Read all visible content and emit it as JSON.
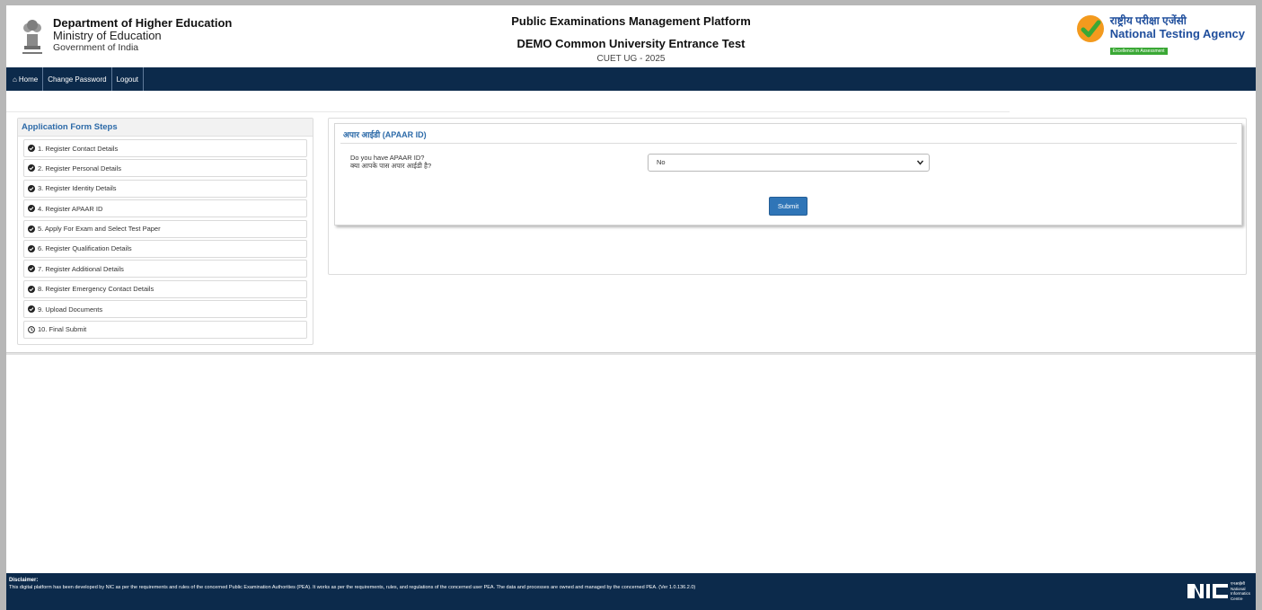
{
  "header": {
    "dept_title": "Department of Higher Education",
    "ministry": "Ministry of Education",
    "government": "Government of India",
    "platform_title": "Public Examinations Management Platform",
    "exam_title": "DEMO Common University Entrance Test",
    "exam_code": "CUET UG - 2025",
    "agency_hindi": "राष्ट्रीय परीक्षा एजेंसी",
    "agency_name": "National Testing Agency",
    "agency_tagline": "Excellence in Assessment"
  },
  "nav": {
    "home": "Home",
    "change_password": "Change Password",
    "logout": "Logout"
  },
  "sidebar": {
    "title": "Application Form Steps",
    "steps": [
      {
        "label": "1. Register Contact Details",
        "status": "done"
      },
      {
        "label": "2. Register Personal Details",
        "status": "done"
      },
      {
        "label": "3. Register Identity Details",
        "status": "done"
      },
      {
        "label": "4. Register APAAR ID",
        "status": "done"
      },
      {
        "label": "5. Apply For Exam and Select Test Paper",
        "status": "done"
      },
      {
        "label": "6. Register Qualification Details",
        "status": "done"
      },
      {
        "label": "7. Register Additional Details",
        "status": "done"
      },
      {
        "label": "8. Register Emergency Contact Details",
        "status": "done"
      },
      {
        "label": "9. Upload Documents",
        "status": "done"
      },
      {
        "label": "10. Final Submit",
        "status": "pending"
      }
    ]
  },
  "form": {
    "title": "अपार आईडी (APAAR ID)",
    "question_en": "Do you have APAAR ID?",
    "question_hi": "क्या आपके पास अपार आईडी है?",
    "selected_value": "No",
    "submit_label": "Submit"
  },
  "footer": {
    "disclaimer_title": "Disclaimer:",
    "disclaimer_text": "This digital platform has been developed by NIC as per the requirements and rules of the concerned Public Examination Authorities (PEA). It works as per the requirements, rules, and regulations of the concerned user PEA. The data and processes are owned and managed by the concerned PEA. (Ver 1.0.136.2.0)",
    "nic_hindi": "एनआईसी",
    "nic_line1": "National",
    "nic_line2": "Informatics",
    "nic_line3": "Centre"
  },
  "colors": {
    "navy": "#0c2a4b",
    "link_blue": "#2c6aa8",
    "button_blue": "#2f75b7",
    "nta_green": "#3aa835"
  }
}
